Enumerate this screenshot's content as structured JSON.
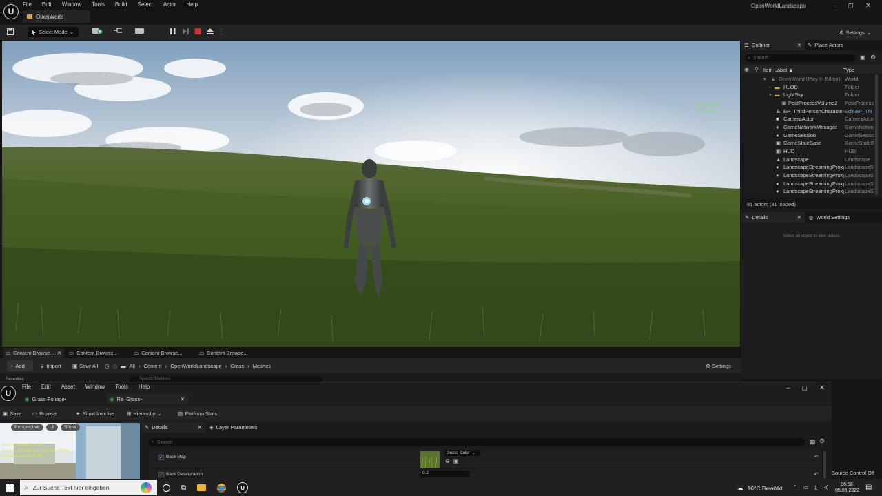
{
  "app": {
    "menu": [
      "File",
      "Edit",
      "Window",
      "Tools",
      "Build",
      "Select",
      "Actor",
      "Help"
    ],
    "level_tab": "OpenWorld",
    "project_name": "OpenWorldLandscape"
  },
  "toolbar": {
    "select_mode": "Select Mode",
    "settings": "Settings"
  },
  "viewport": {
    "fps": "79.12 FPS",
    "ms": "12.54 ms"
  },
  "outliner": {
    "tab": "Outliner",
    "place_actors_tab": "Place Actors",
    "search_placeholder": "Search...",
    "col_label": "Item Label ▲",
    "col_type": "Type",
    "rows": [
      {
        "label": "OpenWorld (Play In Editor)",
        "type": "World"
      },
      {
        "label": "HLOD",
        "type": "Folder"
      },
      {
        "label": "LightSky",
        "type": "Folder"
      },
      {
        "label": "PostProcessVolume2",
        "type": "PostProcess"
      },
      {
        "label": "BP_ThirdPersonCharacter",
        "type": "Edit BP_Thi"
      },
      {
        "label": "CameraActor",
        "type": "CameraActo"
      },
      {
        "label": "GameNetworkManager",
        "type": "GameNetwo"
      },
      {
        "label": "GameSession",
        "type": "GameSessic"
      },
      {
        "label": "GameStateBase",
        "type": "GameStateB"
      },
      {
        "label": "HUD",
        "type": "HUD"
      },
      {
        "label": "Landscape",
        "type": "Landscape"
      },
      {
        "label": "LandscapeStreamingProxy",
        "type": "LandscapeS"
      },
      {
        "label": "LandscapeStreamingProxy",
        "type": "LandscapeS"
      },
      {
        "label": "LandscapeStreamingProxy",
        "type": "LandscapeS"
      },
      {
        "label": "LandscapeStreamingProxy",
        "type": "LandscapeS"
      }
    ],
    "status": "81 actors (81 loaded)"
  },
  "details": {
    "tab": "Details",
    "world_settings_tab": "World Settings",
    "empty_hint": "Select an object to view details."
  },
  "content_browser": {
    "tabs": [
      "Content Browse...",
      "Content Browse...",
      "Content Browse...",
      "Content Browse..."
    ],
    "add": "Add",
    "import": "Import",
    "save_all": "Save All",
    "breadcrumb": [
      "All",
      "Content",
      "OpenWorldLandscape",
      "Grass",
      "Meshes"
    ],
    "settings": "Settings",
    "favorites": "Favorites",
    "search_placeholder": "Search Meshes"
  },
  "material_editor": {
    "menu": [
      "File",
      "Edit",
      "Asset",
      "Window",
      "Tools",
      "Help"
    ],
    "tabs": [
      "Grass-Foliage•",
      "Re_Grass•"
    ],
    "toolbar": {
      "save": "Save",
      "browse": "Browse",
      "show_inactive": "Show Inactive",
      "hierarchy": "Hierarchy",
      "platform_stats": "Platform Stats"
    },
    "viewport_buttons": [
      "Perspective",
      "Lit",
      "Show"
    ],
    "stats": [
      "Texture samplers: 5/16",
      "Texture Lookups (Est.): VS(4), PS(3)",
      "Instructions added: 40"
    ],
    "details_tab": "Details",
    "layer_params_tab": "Layer Parameters",
    "search_placeholder": "Search",
    "params": [
      {
        "name": "Back Map",
        "value": "Grass_Color"
      },
      {
        "name": "Back Desaturation",
        "value": "0.2"
      }
    ],
    "source_control": "Source Control Off"
  },
  "taskbar": {
    "search_placeholder": "Zur Suche Text hier eingeben",
    "weather": "16°C  Bewölkt",
    "time": "06:58",
    "date": "05.06.2022"
  },
  "colors": {
    "accent_green": "#3fa34d",
    "stop_red": "#d03030",
    "folder": "#c9a34a"
  }
}
